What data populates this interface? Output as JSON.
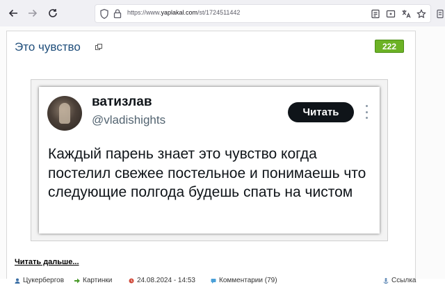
{
  "browser": {
    "url_prefix": "https://www.",
    "url_host": "yaplakal.com",
    "url_path": "/st/1724511442"
  },
  "post": {
    "title": "Это чувство",
    "rating": "222",
    "read_more": "Читать дальше...",
    "tweet": {
      "name": "ватизлав",
      "handle": "@vladishights",
      "follow_label": "Читать",
      "text": "Каждый парень знает это чувство когда постелил свежее постельное и понимаешь что следующие полгода будешь спать на чистом"
    },
    "meta": {
      "author": "Цукербергов",
      "category": "Картинки",
      "date": "24.08.2024 - 14:53",
      "comments": "Комментарии (79)",
      "link": "Ссылка"
    }
  },
  "colors": {
    "title": "#1f4e7b",
    "rating_bg": "#6cb225",
    "toolbar_bg": "#f0f0f4"
  }
}
